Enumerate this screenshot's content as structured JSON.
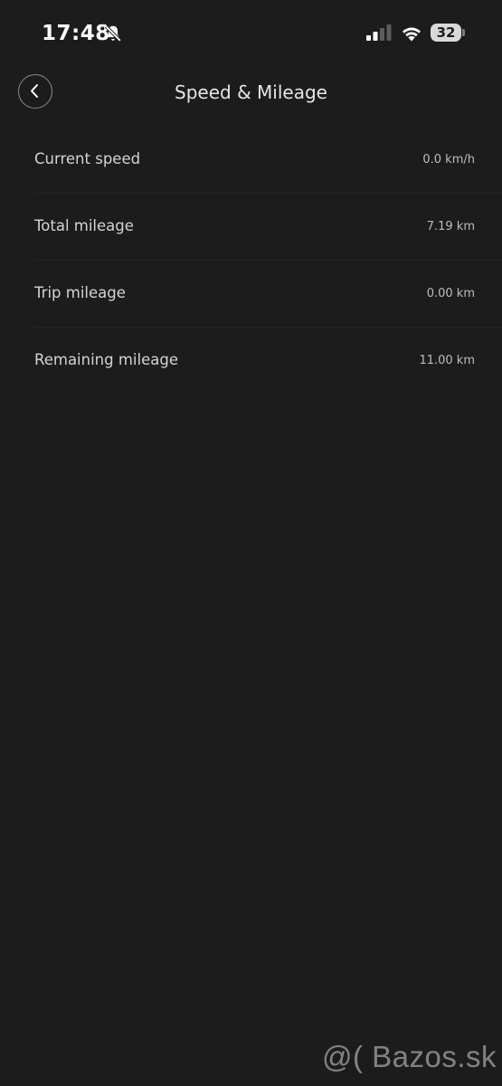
{
  "status_bar": {
    "time": "17:48",
    "battery_level": "32"
  },
  "header": {
    "title": "Speed & Mileage"
  },
  "rows": [
    {
      "label": "Current speed",
      "value": "0.0 km/h"
    },
    {
      "label": "Total mileage",
      "value": "7.19 km"
    },
    {
      "label": "Trip mileage",
      "value": "0.00 km"
    },
    {
      "label": "Remaining mileage",
      "value": "11.00 km"
    }
  ],
  "watermark": "@( Bazos.sk",
  "icons": {
    "bell": "bell-slash-icon",
    "signal": "cellular-signal-icon",
    "wifi": "wifi-icon",
    "back": "chevron-left-icon"
  },
  "colors": {
    "background": "#1c1c1c",
    "text_primary": "#d4d4d4",
    "text_secondary": "#bdbdbd"
  }
}
